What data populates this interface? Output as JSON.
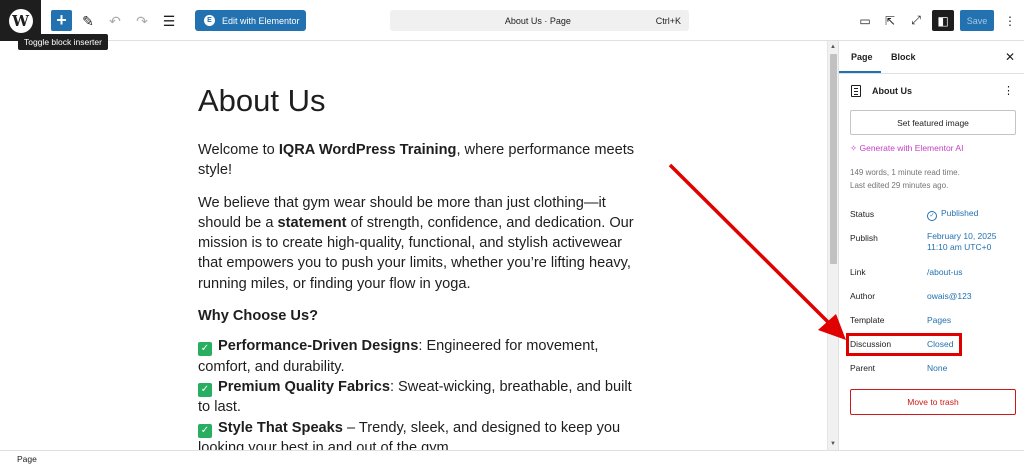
{
  "topbar": {
    "logo": "W",
    "tooltip": "Toggle block inserter",
    "elementor_button": "Edit with Elementor",
    "elementor_badge": "E",
    "command_title": "About Us · Page",
    "command_shortcut": "Ctrl+K",
    "save_label": "Save",
    "icons": [
      "plus-icon",
      "pencil-icon",
      "undo-icon",
      "redo-icon",
      "document-overview-icon",
      "desktop-preview-icon",
      "external-view-icon",
      "fullscreen-icon",
      "settings-sidebar-icon",
      "more-options-icon"
    ]
  },
  "content": {
    "page_title": "About Us",
    "intro_prefix": "Welcome to ",
    "intro_bold": "IQRA WordPress Training",
    "intro_suffix": ", where performance meets style!",
    "p2_prefix": "We believe that gym wear should be more than just clothing—it should be a ",
    "p2_bold": "statement",
    "p2_suffix": " of strength, confidence, and dedication. Our mission is to create high-quality, functional, and stylish activewear that empowers you to push your limits, whether you’re lifting heavy, running miles, or finding your flow in yoga.",
    "heading": "Why Choose Us?",
    "features": [
      {
        "title": "Performance-Driven Designs",
        "text": ": Engineered for movement, comfort, and durability."
      },
      {
        "title": "Premium Quality Fabrics",
        "text": ": Sweat-wicking, breathable, and built to last."
      },
      {
        "title": "Style That Speaks",
        "text": " – Trendy, sleek, and designed to keep you looking your best in and out of the gym."
      }
    ]
  },
  "sidebar": {
    "tab_page": "Page",
    "tab_block": "Block",
    "summary_title": "About Us",
    "featured_image_button": "Set featured image",
    "ai_link": "Generate with Elementor AI",
    "words": "149 words, 1 minute read time.",
    "last_edited": "Last edited 29 minutes ago.",
    "rows": {
      "status": {
        "label": "Status",
        "value": "Published"
      },
      "publish": {
        "label": "Publish",
        "value": "February 10, 2025",
        "value2": "11:10 am UTC+0"
      },
      "link": {
        "label": "Link",
        "value": "/about-us"
      },
      "author": {
        "label": "Author",
        "value": "owais@123"
      },
      "template": {
        "label": "Template",
        "value": "Pages"
      },
      "discussion": {
        "label": "Discussion",
        "value": "Closed"
      },
      "parent": {
        "label": "Parent",
        "value": "None"
      }
    },
    "trash_button": "Move to trash"
  },
  "footer": {
    "breadcrumb": "Page"
  },
  "colors": {
    "accent": "#2271b1",
    "annotation": "#e00000",
    "danger": "#cc1818",
    "ai": "#c53fc0"
  }
}
